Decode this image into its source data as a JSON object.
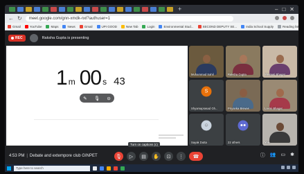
{
  "browser": {
    "tabs": [
      "#3f8f4a",
      "#4a7fd4",
      "#c9a227",
      "#4a7fd4",
      "#3f8f4a",
      "#c94a4a",
      "#4a7fd4",
      "#3f8f4a",
      "#c9a227",
      "#4a7fd4",
      "#c94a4a",
      "#3f8f4a",
      "#4a7fd4",
      "#c9a227",
      "#4a7fd4",
      "#3f8f4a",
      "#c94a4a",
      "#4a7fd4",
      "#3f8f4a",
      "#c9a227"
    ],
    "new_tab": "+",
    "address": "meet.google.com/gnn-xmdk-nxl?authuser=1",
    "bookmarks": [
      {
        "label": "Gmail",
        "color": "#ea4335"
      },
      {
        "label": "YouTube",
        "color": "#ff0000"
      },
      {
        "label": "Maps",
        "color": "#34a853"
      },
      {
        "label": "News",
        "color": "#4285f4"
      },
      {
        "label": "Gmail",
        "color": "#ea4335"
      },
      {
        "label": "UPI GOOD",
        "color": "#4285f4"
      },
      {
        "label": "New Tab",
        "color": "#fbbc05"
      },
      {
        "label": "Login",
        "color": "#34a853"
      },
      {
        "label": "Environmental Stud...",
        "color": "#4285f4"
      },
      {
        "label": "SECOND DEPUTY SE...",
        "color": "#ea4335"
      },
      {
        "label": "India School Supply",
        "color": "#4285f4"
      },
      {
        "label": "Reading list",
        "color": "#9aa0a6"
      }
    ]
  },
  "meet": {
    "rec_label": "REC",
    "presenting": "Raksha Gupta is presenting",
    "timer": {
      "minutes": "1",
      "minutes_unit": "m",
      "seconds": "00",
      "seconds_unit": "s",
      "hundredths": "43"
    },
    "participants": [
      {
        "name": "Muhammad Sahil",
        "bg": "#6b5a3e",
        "skin": "#8a6043",
        "shirt": "#2b3a5e"
      },
      {
        "name": "Raksha Gupta",
        "bg": "#8a7a5f",
        "skin": "#a8775a",
        "shirt": "#7a2f3f"
      },
      {
        "name": "Shrimati Bhagat",
        "bg": "#c9b9a6",
        "skin": "#9a6b4e",
        "shirt": "#6a3f6e"
      },
      {
        "name": "Shyamaprasad Gh...",
        "avatar": "S",
        "avatar_color": "#e8710a"
      },
      {
        "name": "Priyanka Biswas",
        "bg": "#7a6a55",
        "skin": "#8a5d43",
        "shirt": "#4a6a8a"
      },
      {
        "name": "Laxmi Bhagat",
        "bg": "#9a8a74",
        "skin": "#a06a4c",
        "shirt": "#a63a4a"
      },
      {
        "name": "Sayak Dutta",
        "avatar": "photo",
        "avatar_color": "#c9d3de"
      },
      {
        "name": "22 others",
        "avatar": "group",
        "avatar_color": "#5e6ad2"
      },
      {
        "name": "You",
        "bg": "#b8b4ae",
        "skin": "#6b4a36",
        "shirt": "#3a3a3a"
      }
    ],
    "meeting_time": "4:53 PM",
    "meeting_name": "Debate and extempore club GINPET",
    "tooltip": "Turn on captions (c)"
  },
  "taskbar": {
    "search_placeholder": "Type here to search"
  }
}
